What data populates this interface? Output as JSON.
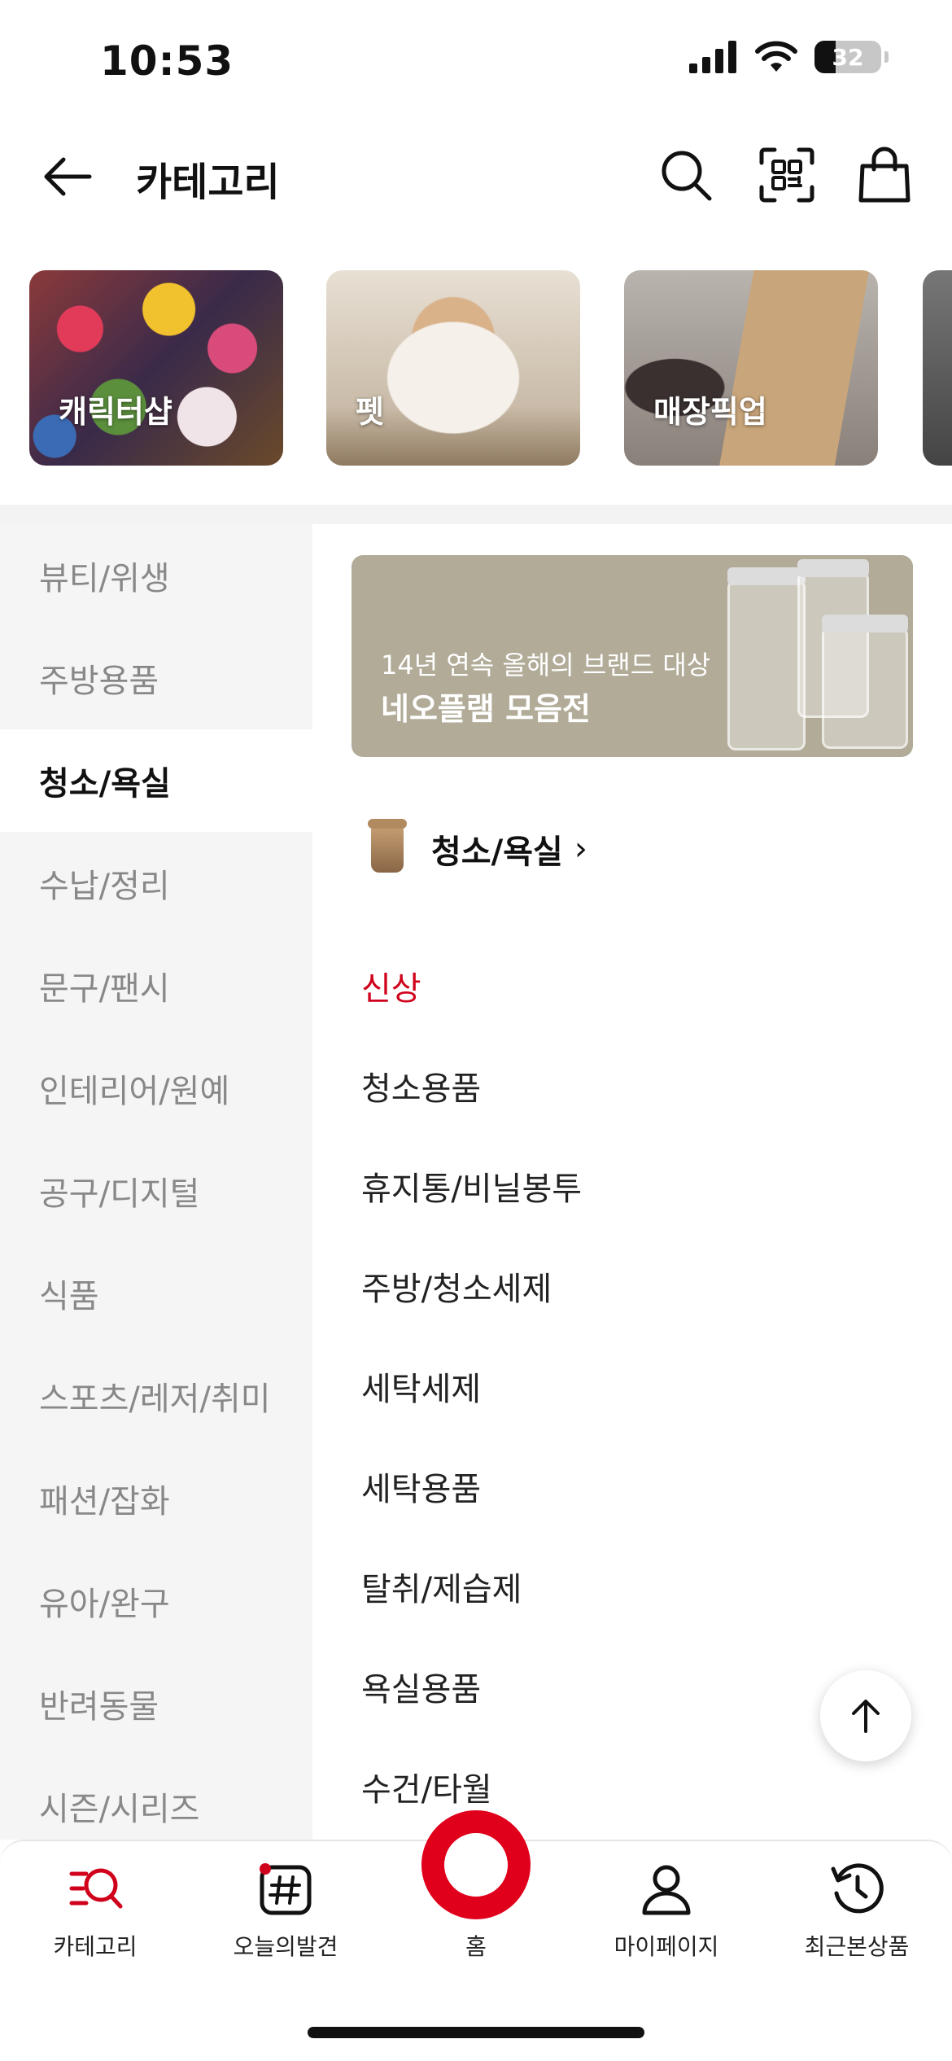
{
  "status_bar": {
    "time": "10:53",
    "battery": "32"
  },
  "header": {
    "title": "카테고리"
  },
  "featured": [
    {
      "label": "캐릭터샵"
    },
    {
      "label": "펫"
    },
    {
      "label": "매장픽업"
    }
  ],
  "sidebar": {
    "items": [
      {
        "label": "뷰티/위생"
      },
      {
        "label": "주방용품"
      },
      {
        "label": "청소/욕실"
      },
      {
        "label": "수납/정리"
      },
      {
        "label": "문구/팬시"
      },
      {
        "label": "인테리어/원예"
      },
      {
        "label": "공구/디지털"
      },
      {
        "label": "식품"
      },
      {
        "label": "스포츠/레저/취미"
      },
      {
        "label": "패션/잡화"
      },
      {
        "label": "유아/완구"
      },
      {
        "label": "반려동물"
      },
      {
        "label": "시즌/시리즈"
      }
    ],
    "active_index": 2
  },
  "banner": {
    "subtitle": "14년 연속 올해의 브랜드 대상",
    "title": "네오플램 모음전"
  },
  "category": {
    "heading": "청소/욕실",
    "chevron": "›",
    "subcategories": [
      {
        "label": "신상"
      },
      {
        "label": "청소용품"
      },
      {
        "label": "휴지통/비닐봉투"
      },
      {
        "label": "주방/청소세제"
      },
      {
        "label": "세탁세제"
      },
      {
        "label": "세탁용품"
      },
      {
        "label": "탈취/제습제"
      },
      {
        "label": "욕실용품"
      },
      {
        "label": "수건/타월"
      }
    ]
  },
  "tabbar": {
    "category": "카테고리",
    "discover": "오늘의발견",
    "home": "홈",
    "mypage": "마이페이지",
    "recent": "최근본상품"
  },
  "colors": {
    "accent": "#e0001b",
    "new_label": "#d0021b",
    "banner_bg": "#b1ab98"
  }
}
